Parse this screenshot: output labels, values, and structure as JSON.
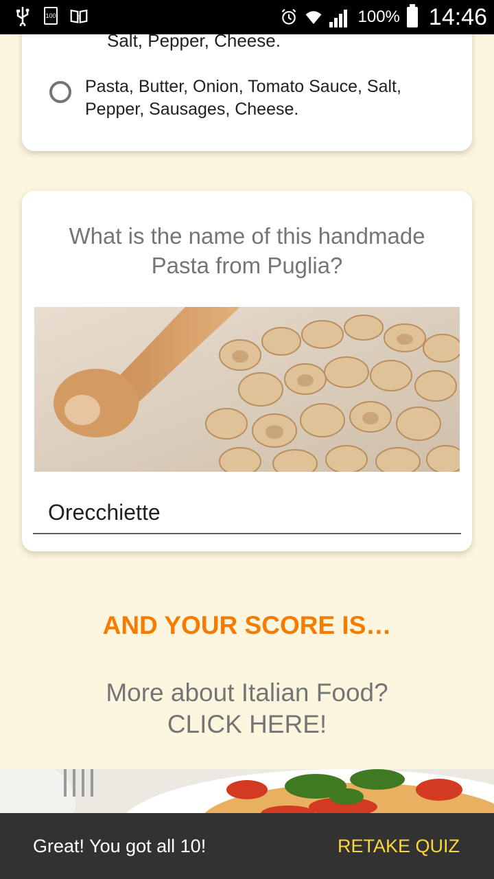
{
  "status_bar": {
    "battery_label": "100",
    "battery_percent": "100%",
    "time": "14:46",
    "left_icons": [
      "usb-icon",
      "battery-100-icon",
      "amazon-books-icon"
    ],
    "right_icons": [
      "alarm-icon",
      "wifi-icon",
      "signal-icon",
      "battery-icon"
    ]
  },
  "previous_question": {
    "cut_off_option": "Salt, Pepper, Cheese.",
    "option": "Pasta, Butter, Onion, Tomato Sauce, Salt, Pepper, Sausages, Cheese."
  },
  "question_card": {
    "question": "What is the name of this handmade Pasta from Puglia?",
    "image": "orecchiette-pasta-photo",
    "answer": "Orecchiette"
  },
  "score_heading": "AND YOUR SCORE IS…",
  "more_link": {
    "line1": "More about Italian Food?",
    "line2": "CLICK HERE!"
  },
  "banner_image": "spaghetti-photo",
  "snackbar": {
    "message": "Great! You got all 10!",
    "action": "RETAKE QUIZ"
  },
  "colors": {
    "background": "#fdf6df",
    "accent_orange": "#f57c00",
    "snackbar_action": "#fdd835"
  }
}
